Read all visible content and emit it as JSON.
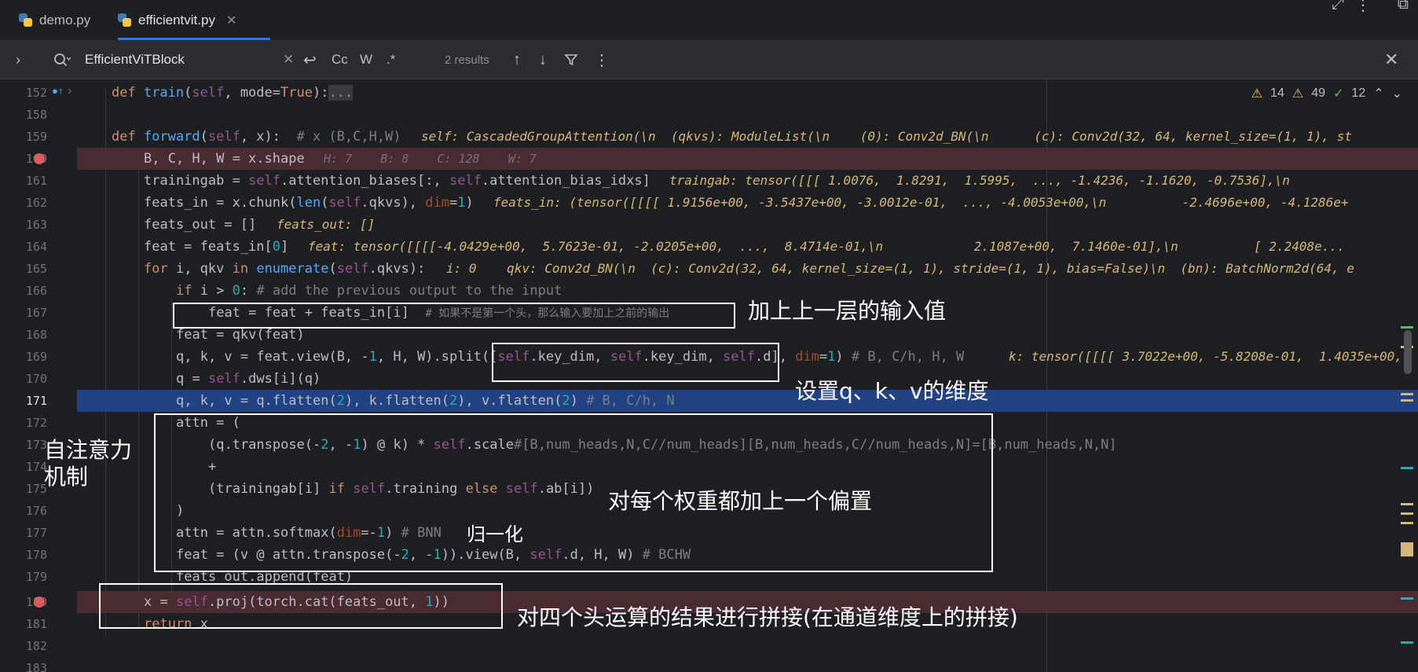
{
  "tabs": [
    {
      "label": "demo.py",
      "active": false
    },
    {
      "label": "efficientvit.py",
      "active": true
    }
  ],
  "search": {
    "query": "EfficientViTBlock",
    "results": "2 results",
    "opt_case": "Cc",
    "opt_words": "W",
    "opt_regex": ".*"
  },
  "status": {
    "warn1": "14",
    "warn2": "49",
    "ok": "12"
  },
  "lines": {
    "l152": "152",
    "l158": "158",
    "l159": "159",
    "l160": "160",
    "l161": "161",
    "l162": "162",
    "l163": "163",
    "l164": "164",
    "l165": "165",
    "l166": "166",
    "l167": "167",
    "l168": "168",
    "l169": "169",
    "l170": "170",
    "l171": "171",
    "l172": "172",
    "l173": "173",
    "l174": "174",
    "l175": "175",
    "l176": "176",
    "l177": "177",
    "l178": "178",
    "l179": "179",
    "l180": "180",
    "l181": "181",
    "l182": "182",
    "l183": "183"
  },
  "code": {
    "c159_hint": "self: CascadedGroupAttention(\\n  (qkvs): ModuleList(\\n    (0): Conv2d_BN(\\n      (c): Conv2d(32, 64, kernel_size=(1, 1), st",
    "c160_hint": "H: 7    B: 8    C: 128    W: 7",
    "c161_hint": "traingab: tensor([[[ 1.0076,  1.8291,  1.5995,  ..., -1.4236, -1.1620, -0.7536],\\n",
    "c162_hint": "feats_in: (tensor([[[[ 1.9156e+00, -3.5437e+00, -3.0012e-01,  ..., -4.0053e+00,\\n          -2.4696e+00, -4.1286e+",
    "c163_hint": "feats_out: []",
    "c164_hint": "feat: tensor([[[[-4.0429e+00,  5.7623e-01, -2.0205e+00,  ...,  8.4714e-01,\\n            2.1087e+00,  7.1460e-01],\\n          [ 2.2408e...",
    "c165_hint": "i: 0    qkv: Conv2d_BN(\\n  (c): Conv2d(32, 64, kernel_size=(1, 1), stride=(1, 1), bias=False)\\n  (bn): BatchNorm2d(64, e",
    "c169_hint": "k: tensor([[[[ 3.7022e+00, -5.8208e-01,  1.4035e+00,"
  },
  "annotations": {
    "a1": "加上上一层的输入值",
    "a2": "设置q、k、v的维度",
    "a3": "自注意力\n机制",
    "a4": "对每个权重都加上一个偏置",
    "a5": "归一化",
    "a6": "对四个头运算的结果进行拼接(在通道维度上的拼接)"
  }
}
